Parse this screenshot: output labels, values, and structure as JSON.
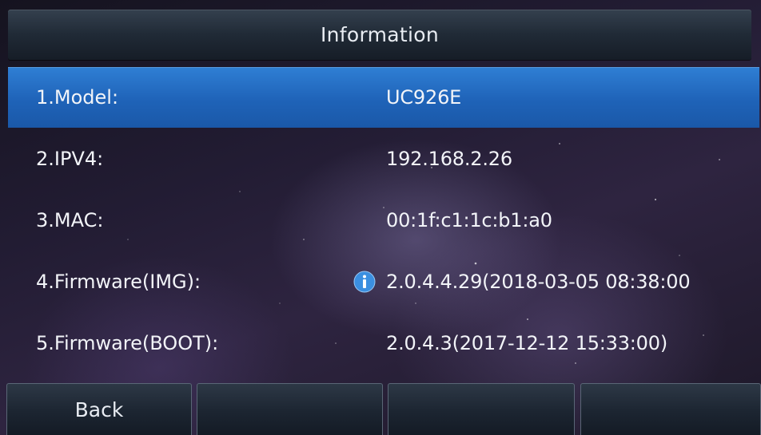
{
  "header": {
    "title": "Information"
  },
  "info_list": {
    "items": [
      {
        "label": "1.Model:",
        "value": "UC926E",
        "selected": true
      },
      {
        "label": "2.IPV4:",
        "value": "192.168.2.26",
        "selected": false
      },
      {
        "label": "3.MAC:",
        "value": "00:1f:c1:1c:b1:a0",
        "selected": false
      },
      {
        "label": "4.Firmware(IMG):",
        "value": "2.0.4.4.29(2018-03-05 08:38:00",
        "selected": false,
        "icon": "info-icon"
      },
      {
        "label": "5.Firmware(BOOT):",
        "value": "2.0.4.3(2017-12-12 15:33:00)",
        "selected": false
      }
    ]
  },
  "softkeys": {
    "items": [
      {
        "label": "Back"
      },
      {
        "label": ""
      },
      {
        "label": ""
      },
      {
        "label": ""
      }
    ]
  },
  "colors": {
    "selected_row": "#2369c0",
    "info_icon": "#3b8fe0"
  }
}
